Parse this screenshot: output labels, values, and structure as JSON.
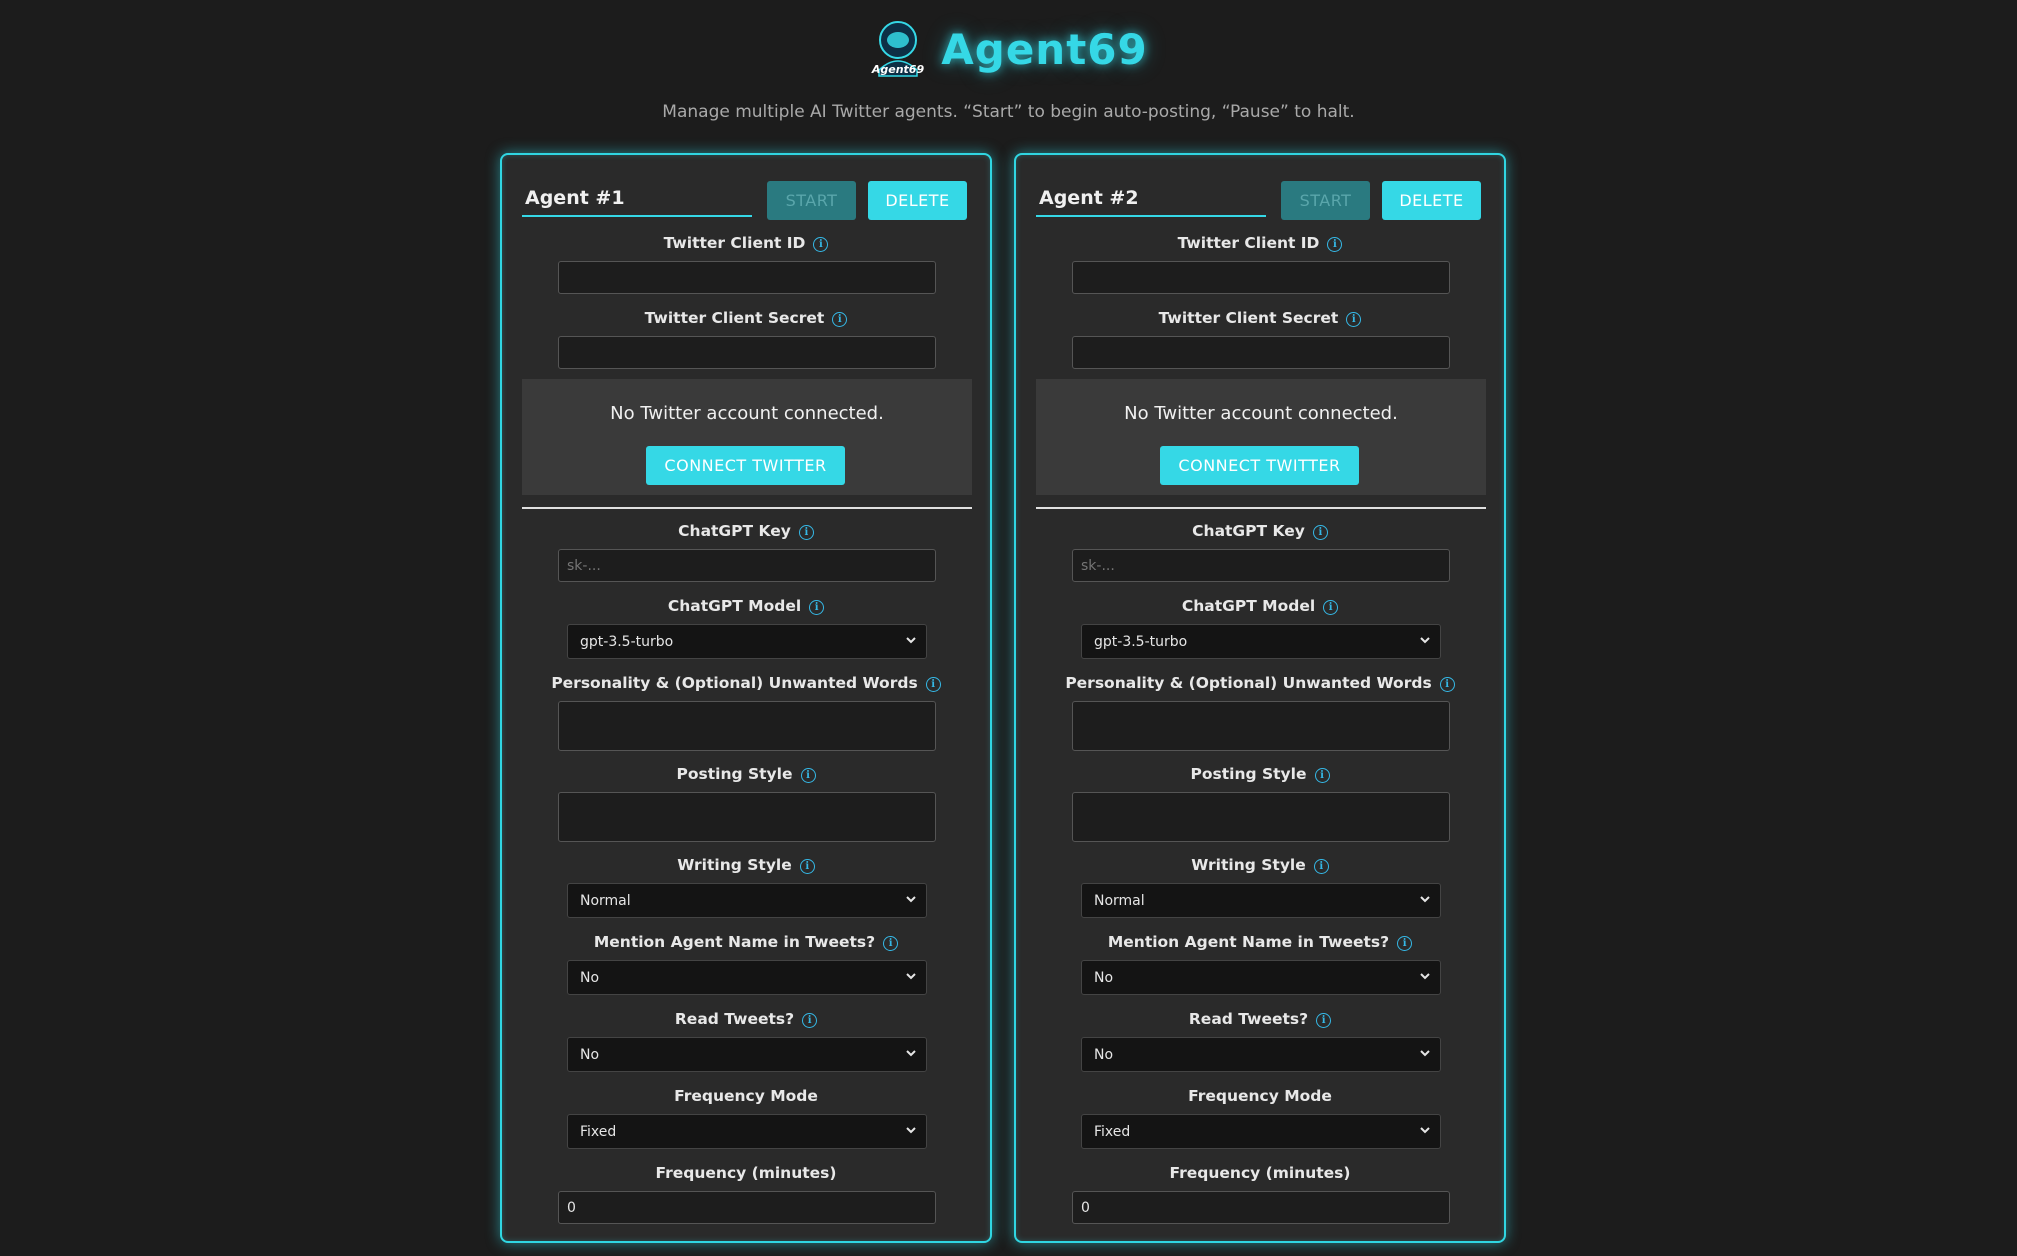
{
  "app": {
    "title": "Agent69",
    "logo_text": "Agent69",
    "subtitle": "Manage multiple AI Twitter agents. “Start” to begin auto-posting, “Pause” to halt."
  },
  "colors": {
    "accent": "#35d8e6",
    "background": "#1c1c1c",
    "card": "#2a2a2a",
    "start_disabled": "#2a7a80"
  },
  "agents": [
    {
      "name": "Agent #1",
      "start_label": "START",
      "delete_label": "DELETE",
      "client_id_label": "Twitter Client ID",
      "client_id_value": "",
      "client_secret_label": "Twitter Client Secret",
      "client_secret_value": "",
      "connection_status": "No Twitter account connected.",
      "connect_label": "CONNECT TWITTER",
      "chatgpt_key_label": "ChatGPT Key",
      "chatgpt_key_placeholder": "sk-...",
      "model_label": "ChatGPT Model",
      "model_value": "gpt-3.5-turbo",
      "personality_label": "Personality & (Optional) Unwanted Words",
      "posting_style_label": "Posting Style",
      "writing_style_label": "Writing Style",
      "writing_style_value": "Normal",
      "mention_label": "Mention Agent Name in Tweets?",
      "mention_value": "No",
      "read_label": "Read Tweets?",
      "read_value": "No",
      "freq_mode_label": "Frequency Mode",
      "freq_mode_value": "Fixed",
      "freq_minutes_label": "Frequency (minutes)",
      "freq_minutes_value": "0"
    },
    {
      "name": "Agent #2",
      "start_label": "START",
      "delete_label": "DELETE",
      "client_id_label": "Twitter Client ID",
      "client_id_value": "",
      "client_secret_label": "Twitter Client Secret",
      "client_secret_value": "",
      "connection_status": "No Twitter account connected.",
      "connect_label": "CONNECT TWITTER",
      "chatgpt_key_label": "ChatGPT Key",
      "chatgpt_key_placeholder": "sk-...",
      "model_label": "ChatGPT Model",
      "model_value": "gpt-3.5-turbo",
      "personality_label": "Personality & (Optional) Unwanted Words",
      "posting_style_label": "Posting Style",
      "writing_style_label": "Writing Style",
      "writing_style_value": "Normal",
      "mention_label": "Mention Agent Name in Tweets?",
      "mention_value": "No",
      "read_label": "Read Tweets?",
      "read_value": "No",
      "freq_mode_label": "Frequency Mode",
      "freq_mode_value": "Fixed",
      "freq_minutes_label": "Frequency (minutes)",
      "freq_minutes_value": "0"
    }
  ]
}
